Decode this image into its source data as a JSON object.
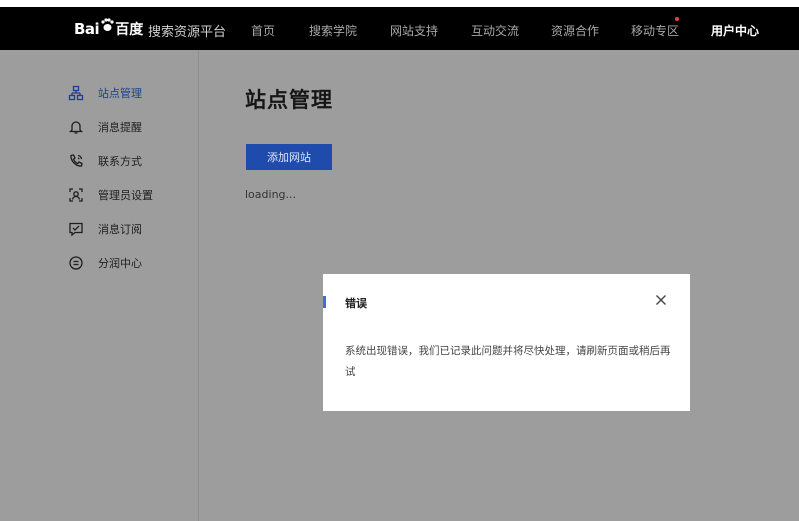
{
  "header": {
    "logo_text_bai": "Bai",
    "logo_text_du": "百度",
    "platform": "搜索资源平台",
    "nav": [
      {
        "label": "首页"
      },
      {
        "label": "搜索学院"
      },
      {
        "label": "网站支持"
      },
      {
        "label": "互动交流"
      },
      {
        "label": "资源合作"
      },
      {
        "label": "移动专区"
      },
      {
        "label": "用户中心"
      }
    ]
  },
  "sidebar": {
    "items": [
      {
        "label": "站点管理",
        "icon": "sitemap-icon"
      },
      {
        "label": "消息提醒",
        "icon": "bell-icon"
      },
      {
        "label": "联系方式",
        "icon": "phone-icon"
      },
      {
        "label": "管理员设置",
        "icon": "admin-icon"
      },
      {
        "label": "消息订阅",
        "icon": "subscribe-icon"
      },
      {
        "label": "分润中心",
        "icon": "revenue-icon"
      }
    ]
  },
  "main": {
    "title": "站点管理",
    "add_button": "添加网站",
    "loading": "loading..."
  },
  "modal": {
    "title": "错误",
    "message": "系统出现错误，我们已记录此问题并将尽快处理，请刷新页面或稍后再试"
  },
  "colors": {
    "overlay": "#9d9d9d",
    "header_bg": "#000000",
    "accent": "#1f4bac",
    "active_nav": "#1d3f8f"
  }
}
